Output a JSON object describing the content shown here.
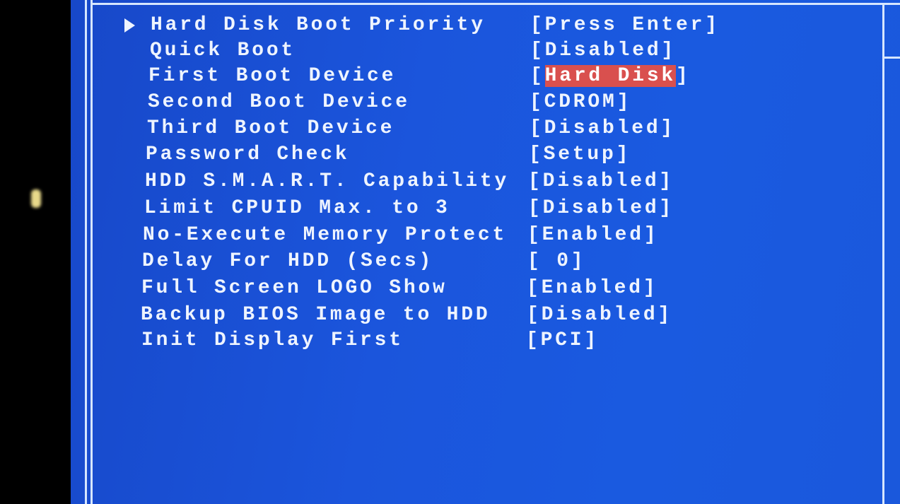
{
  "bios_menu": {
    "items": [
      {
        "label": "Hard Disk Boot Priority",
        "value": "[Press Enter]",
        "submenu": true
      },
      {
        "label": "Quick Boot",
        "value": "[Disabled]"
      },
      {
        "label": "First Boot Device",
        "value_open": "[",
        "value_selected": "Hard Disk",
        "value_close": "]",
        "selected": true
      },
      {
        "label": "Second Boot Device",
        "value": "[CDROM]"
      },
      {
        "label": "Third Boot Device",
        "value": "[Disabled]"
      },
      {
        "label": "Password Check",
        "value": "[Setup]"
      },
      {
        "label": "HDD S.M.A.R.T. Capability",
        "value": "[Disabled]"
      },
      {
        "label": "Limit CPUID Max. to 3",
        "value": "[Disabled]"
      },
      {
        "label": "No-Execute Memory Protect",
        "value": "[Enabled]"
      },
      {
        "label": "Delay For HDD (Secs)",
        "value": "[ 0]"
      },
      {
        "label": "Full Screen LOGO Show",
        "value": "[Enabled]"
      },
      {
        "label": "Backup BIOS Image to HDD",
        "value": "[Disabled]"
      },
      {
        "label": "Init Display First",
        "value": "[PCI]"
      }
    ]
  },
  "colors": {
    "background": "#1a55dc",
    "text": "#eef4ff",
    "highlight": "#d9504e",
    "border": "#d6e6ff"
  },
  "icons": {
    "submenu": "triangle-right-icon"
  }
}
